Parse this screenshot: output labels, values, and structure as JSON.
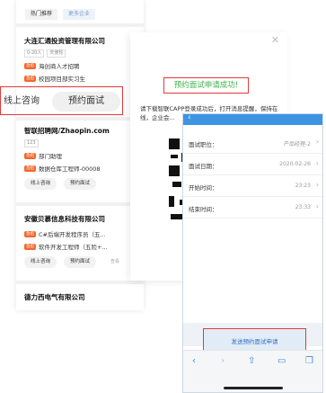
{
  "job_list": {
    "tabs": [
      "热门推荐",
      "更多企业"
    ],
    "companies": [
      {
        "name": "大连汇通投资管理有限公司",
        "tags": [
          "0-20人",
          "天使轮"
        ],
        "jobs": [
          {
            "badge": "急招",
            "title": "海创商人才招聘"
          },
          {
            "badge": "急招",
            "title": "校园项目部实习生"
          }
        ]
      },
      {
        "name": "智联招聘网/Zhaopin.com",
        "tags": [
          "123"
        ],
        "jobs": [
          {
            "badge": "急招",
            "title": "部门助理"
          },
          {
            "badge": "急招",
            "title": "数据仓库工程师-00008"
          }
        ],
        "buttons": [
          "线上咨询",
          "预约面试"
        ]
      },
      {
        "name": "安徽贝慕信息科技有限公司",
        "jobs": [
          {
            "badge": "急招",
            "title": "C#后端开发程序员（五..."
          },
          {
            "badge": "急招",
            "title": "软件开发工程师（五险+..."
          }
        ],
        "buttons": [
          "线上咨询",
          "预约面试"
        ],
        "extra": "查看"
      },
      {
        "name": "德力西电气有限公司"
      }
    ],
    "highlighted_buttons": {
      "online": "线上咨询",
      "interview": "预约面试"
    }
  },
  "modal": {
    "close_icon": "close-icon",
    "success_title": "预约面试申请成功!",
    "description": "请下载智联CAPP登录成功后，打开消息提醒，保持在线，企业会..."
  },
  "phone": {
    "fields": [
      {
        "label": "面试职位：",
        "value": "产品经理-2"
      },
      {
        "label": "面试日期：",
        "value": "2020-02-26"
      },
      {
        "label": "开始时间：",
        "value": "23:23"
      },
      {
        "label": "结束时间：",
        "value": "23:33"
      }
    ],
    "submit_label": "发送预约面试申请",
    "toolbar_icons": [
      "back-icon",
      "forward-icon",
      "share-icon",
      "book-icon",
      "tabs-icon"
    ]
  },
  "colors": {
    "accent_red": "#e23a3a",
    "success_green": "#3cb34a",
    "header_blue": "#3d94e3",
    "hot_badge": "#f3672e"
  }
}
